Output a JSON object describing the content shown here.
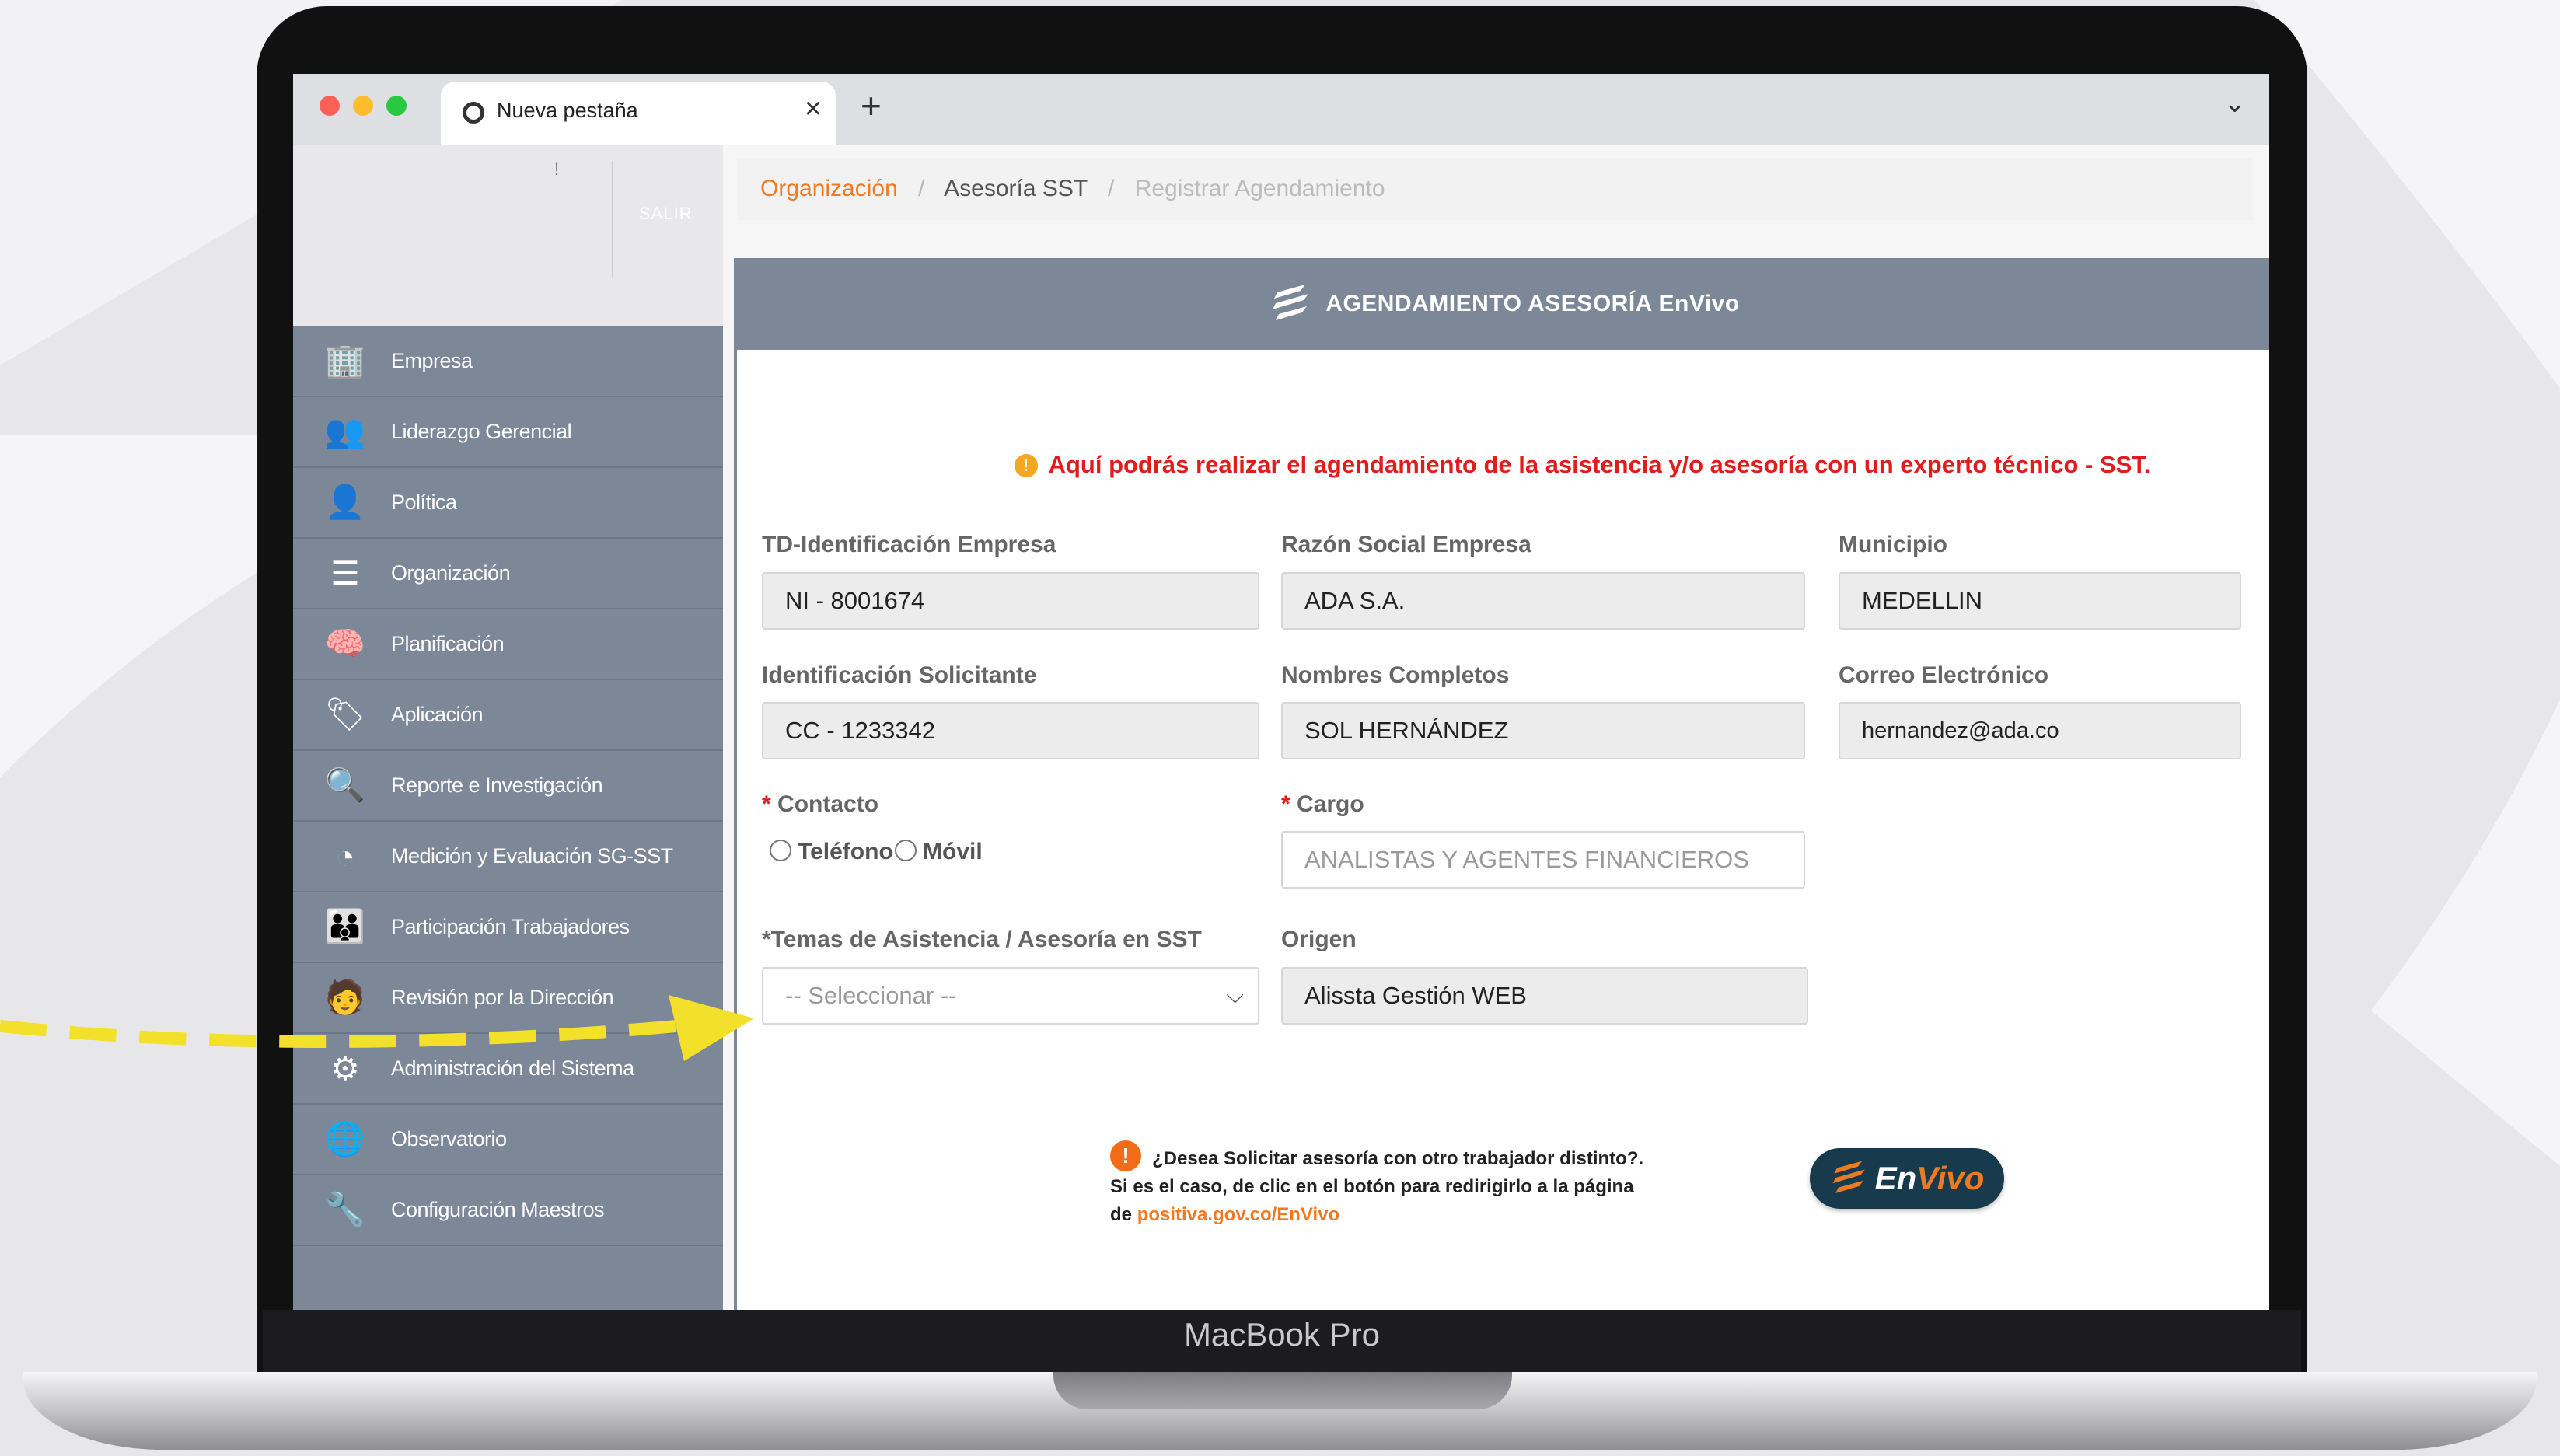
{
  "browser": {
    "tab_title": "Nueva pestaña",
    "close_glyph": "×",
    "new_tab_glyph": "+",
    "menu_glyph": "⌄"
  },
  "sidebar": {
    "top_mark": "!",
    "logout_label": "SALIR",
    "items": [
      {
        "label": "Empresa",
        "icon": "building-icon",
        "glyph": "🏢"
      },
      {
        "label": "Liderazgo Gerencial",
        "icon": "leadership-icon",
        "glyph": "👥"
      },
      {
        "label": "Política",
        "icon": "user-policy-icon",
        "glyph": "👤"
      },
      {
        "label": "Organización",
        "icon": "list-icon",
        "glyph": "☰"
      },
      {
        "label": "Planificación",
        "icon": "head-gear-icon",
        "glyph": "🧠"
      },
      {
        "label": "Aplicación",
        "icon": "tag-icon",
        "glyph": "🏷"
      },
      {
        "label": "Reporte e Investigación",
        "icon": "magnifier-icon",
        "glyph": "🔍"
      },
      {
        "label": "Medición y Evaluación SG-SST",
        "icon": "pie-chart-icon",
        "glyph": "◔"
      },
      {
        "label": "Participación Trabajadores",
        "icon": "group-icon",
        "glyph": "👪"
      },
      {
        "label": "Revisión por la Dirección",
        "icon": "reviewer-icon",
        "glyph": "🧑"
      },
      {
        "label": "Administración del Sistema",
        "icon": "admin-icon",
        "glyph": "⚙"
      },
      {
        "label": "Observatorio",
        "icon": "globe-icon",
        "glyph": "🌐"
      },
      {
        "label": "Configuración Maestros",
        "icon": "settings-key-icon",
        "glyph": "🔧"
      }
    ]
  },
  "breadcrumb": {
    "org": "Organización",
    "sep": "/",
    "mid": "Asesoría SST",
    "current": "Registrar Agendamiento"
  },
  "panel": {
    "title": "AGENDAMIENTO ASESORÍA EnVivo",
    "notice": "Aquí podrás realizar el agendamiento de la asistencia y/o asesoría con un experto técnico - SST.",
    "info_glyph": "!"
  },
  "form": {
    "td_label": "TD-Identificación Empresa",
    "td_value": "NI - 8001674",
    "razon_label": "Razón Social Empresa",
    "razon_value": "ADA S.A.",
    "municipio_label": "Municipio",
    "municipio_value": "MEDELLIN",
    "id_sol_label": "Identificación Solicitante",
    "id_sol_value": "CC - 1233342",
    "nombres_label": "Nombres Completos",
    "nombres_value": "SOL HERNÁNDEZ",
    "correo_label": "Correo Electrónico",
    "correo_value": "hernandez@ada.co",
    "req_mark": "*",
    "contacto_label": "Contacto",
    "contacto_opt1": "Teléfono",
    "contacto_opt2": "Móvil",
    "cargo_label": "Cargo",
    "cargo_value": "ANALISTAS Y AGENTES FINANCIEROS",
    "temas_label": "*Temas de Asistencia / Asesoría en SST",
    "temas_value": "-- Seleccionar --",
    "origen_label": "Origen",
    "origen_value": "Alissta Gestión WEB",
    "chevron_glyph": "⌵"
  },
  "other_worker": {
    "line1": "¿Desea Solicitar asesoría con otro trabajador distinto?.",
    "line2": "Si es el caso, de clic en el botón para redirigirlo a la página",
    "line3_prefix": "de",
    "link": "positiva.gov.co/EnVivo",
    "button_a": "En",
    "button_b": "Vivo"
  },
  "device": {
    "label": "MacBook Pro"
  },
  "colors": {
    "accent_orange": "#ee7a23",
    "sidebar_bg": "#7c8797",
    "alert_red": "#e21b1b",
    "envivo_dark": "#183a4d",
    "arrow_yellow": "#f2e02a"
  }
}
